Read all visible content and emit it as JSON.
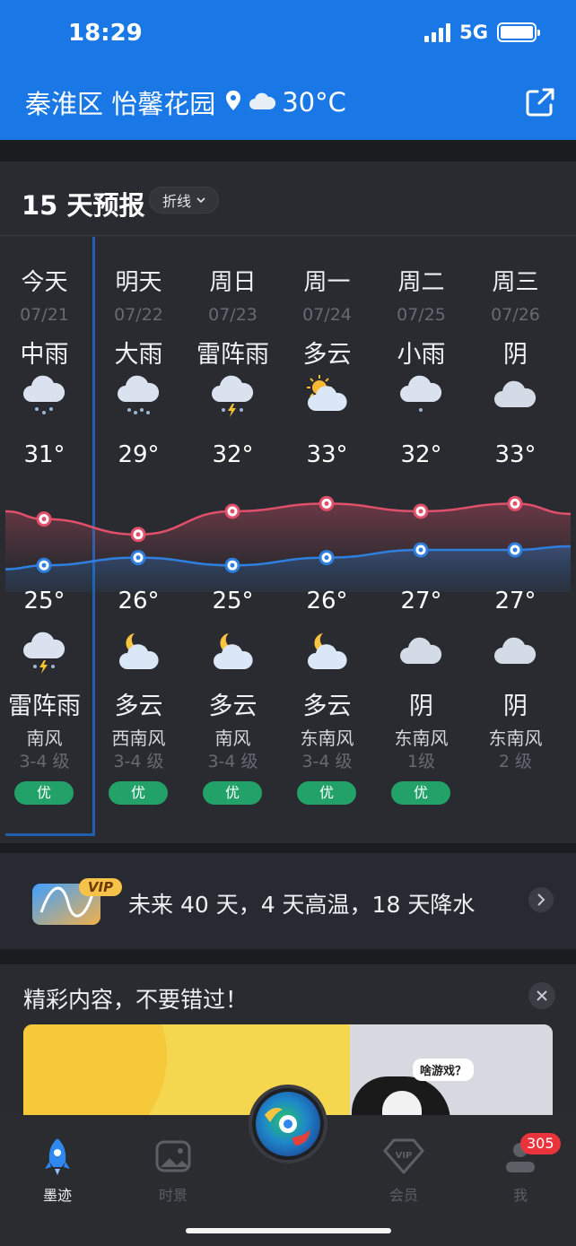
{
  "status": {
    "time": "18:29",
    "network": "5G",
    "battery_level": 1.0
  },
  "header": {
    "location": "秦淮区 怡馨花园",
    "current_temp": "30°C",
    "location_icon": "location-pin-icon",
    "weather_icon": "cloud-icon",
    "share_icon": "share-icon"
  },
  "forecast": {
    "title": "15 天预报",
    "view_toggle": "折线",
    "days": [
      {
        "day": "今天",
        "date": "07/21",
        "day_cond": "中雨",
        "day_icon": "moderate-rain-icon",
        "high": "31°",
        "low": "25°",
        "night_icon": "thunderstorm-icon",
        "night_cond": "雷阵雨",
        "wind_dir": "南风",
        "wind_level": "3-4 级",
        "aqi": "优"
      },
      {
        "day": "明天",
        "date": "07/22",
        "day_cond": "大雨",
        "day_icon": "heavy-rain-icon",
        "high": "29°",
        "low": "26°",
        "night_icon": "partly-cloudy-night-icon",
        "night_cond": "多云",
        "wind_dir": "西南风",
        "wind_level": "3-4 级",
        "aqi": "优"
      },
      {
        "day": "周日",
        "date": "07/23",
        "day_cond": "雷阵雨",
        "day_icon": "thunderstorm-icon",
        "high": "32°",
        "low": "25°",
        "night_icon": "partly-cloudy-night-icon",
        "night_cond": "多云",
        "wind_dir": "南风",
        "wind_level": "3-4 级",
        "aqi": "优"
      },
      {
        "day": "周一",
        "date": "07/24",
        "day_cond": "多云",
        "day_icon": "partly-cloudy-day-icon",
        "high": "33°",
        "low": "26°",
        "night_icon": "partly-cloudy-night-icon",
        "night_cond": "多云",
        "wind_dir": "东南风",
        "wind_level": "3-4 级",
        "aqi": "优"
      },
      {
        "day": "周二",
        "date": "07/25",
        "day_cond": "小雨",
        "day_icon": "light-rain-icon",
        "high": "32°",
        "low": "27°",
        "night_icon": "overcast-icon",
        "night_cond": "阴",
        "wind_dir": "东南风",
        "wind_level": "1级",
        "aqi": "优"
      },
      {
        "day": "周三",
        "date": "07/26",
        "day_cond": "阴",
        "day_icon": "overcast-icon",
        "high": "33°",
        "low": "27°",
        "night_icon": "overcast-icon",
        "night_cond": "阴",
        "wind_dir": "东南风",
        "wind_level": "2 级",
        "aqi": ""
      }
    ]
  },
  "chart_data": {
    "type": "line",
    "categories": [
      "07/21",
      "07/22",
      "07/23",
      "07/24",
      "07/25",
      "07/26"
    ],
    "series": [
      {
        "values": [
          31,
          29,
          32,
          33,
          32,
          33
        ],
        "color": "#e0506b"
      },
      {
        "values": [
          25,
          26,
          25,
          26,
          27,
          27
        ],
        "color": "#2f7fe0"
      }
    ]
  },
  "vip": {
    "badge": "VIP",
    "text": "未来 40 天，4 天高温，18 天降水"
  },
  "recommend": {
    "title": "精彩内容，不要错过！",
    "bubble": "啥游戏？"
  },
  "tabbar": {
    "tabs": [
      {
        "label": "墨迹",
        "icon": "rocket-icon",
        "active": true
      },
      {
        "label": "时景",
        "icon": "photo-icon",
        "active": false
      },
      {
        "label": "会员",
        "icon": "vip-diamond-icon",
        "active": false
      },
      {
        "label": "我",
        "icon": "profile-icon",
        "active": false
      }
    ],
    "badge_count": "305"
  }
}
